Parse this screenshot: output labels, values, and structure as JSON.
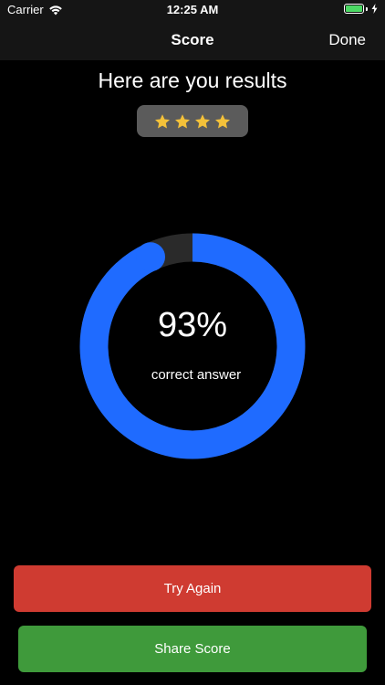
{
  "status_bar": {
    "carrier": "Carrier",
    "time": "12:25 AM",
    "battery_color": "#4cd964"
  },
  "nav": {
    "title": "Score",
    "done_label": "Done"
  },
  "results": {
    "heading": "Here are you results",
    "stars_filled": 4,
    "star_color": "#f3c13a"
  },
  "score": {
    "percent_label": "93%",
    "percent_value": 93,
    "caption": "correct answer",
    "ring_color": "#1f6bff",
    "track_color": "#2a2a2a"
  },
  "buttons": {
    "try_again": "Try Again",
    "share_score": "Share Score"
  }
}
